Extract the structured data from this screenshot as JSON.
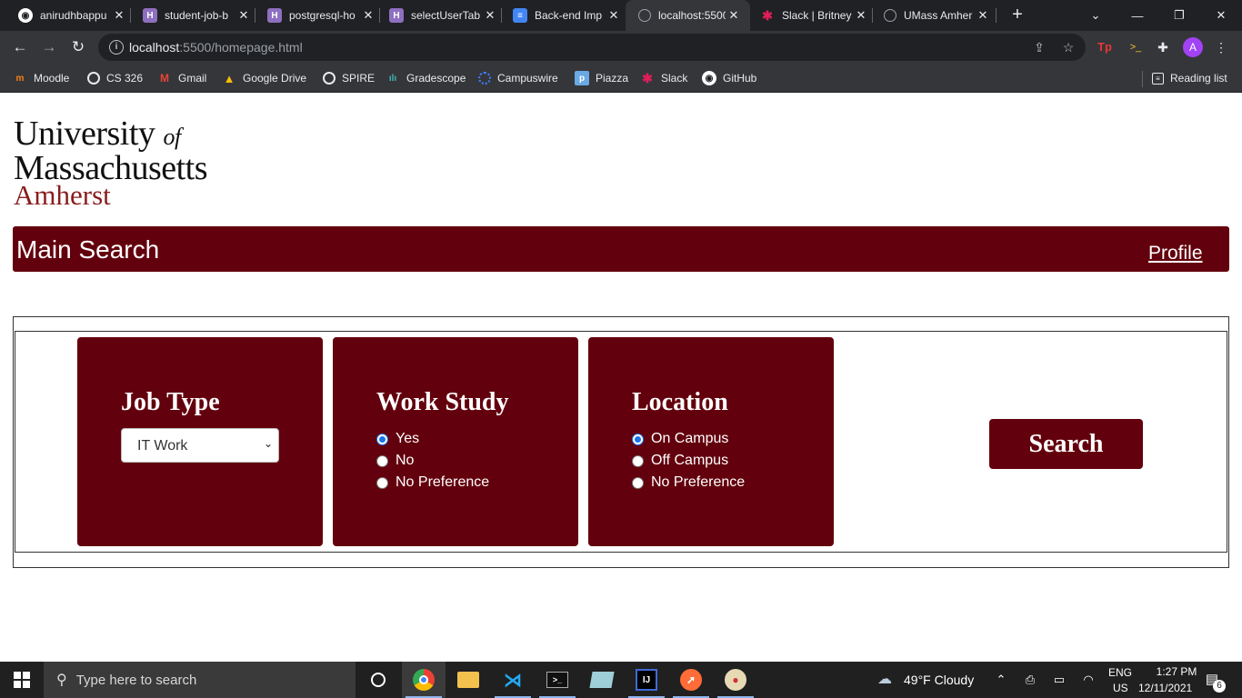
{
  "browser": {
    "tabs": [
      {
        "title": "anirudhbappu",
        "icon": "github-icon",
        "color": "#ffffff"
      },
      {
        "title": "student-job-b",
        "icon": "hackmd-icon",
        "color": "#8e6fc0"
      },
      {
        "title": "postgresql-ho",
        "icon": "hackmd-icon",
        "color": "#8e6fc0"
      },
      {
        "title": "selectUserTab",
        "icon": "hackmd-icon",
        "color": "#8e6fc0"
      },
      {
        "title": "Back-end Imp",
        "icon": "google-docs-icon",
        "color": "#4285f4"
      },
      {
        "title": "localhost:5500",
        "icon": "globe-icon",
        "color": "#9aa0a6"
      },
      {
        "title": "Slack | Britney",
        "icon": "slack-icon",
        "color": "#e01e5a"
      },
      {
        "title": "UMass Amher",
        "icon": "globe-icon",
        "color": "#9aa0a6"
      }
    ],
    "active_tab_index": 5,
    "close_glyph": "✕",
    "new_tab_glyph": "+",
    "url_host": "localhost",
    "url_rest": ":5500/homepage.html",
    "bookmarks": [
      {
        "label": "Moodle",
        "icon": "moodle-icon",
        "color": "#f98012"
      },
      {
        "label": "CS 326",
        "icon": "globe-icon",
        "color": "#e8eaed"
      },
      {
        "label": "Gmail",
        "icon": "gmail-icon",
        "color": "#ea4335"
      },
      {
        "label": "Google Drive",
        "icon": "google-drive-icon",
        "color": "#fbbc04"
      },
      {
        "label": "SPIRE",
        "icon": "globe-icon",
        "color": "#e8eaed"
      },
      {
        "label": "Gradescope",
        "icon": "gradescope-icon",
        "color": "#3fb6b0"
      },
      {
        "label": "Campuswire",
        "icon": "campuswire-icon",
        "color": "#3d7eff"
      },
      {
        "label": "Piazza",
        "icon": "piazza-icon",
        "color": "#6aa9e4"
      },
      {
        "label": "Slack",
        "icon": "slack-icon",
        "color": "#e01e5a"
      },
      {
        "label": "GitHub",
        "icon": "github-icon",
        "color": "#ffffff"
      }
    ],
    "reading_list": "Reading list",
    "profile_initial": "A"
  },
  "page": {
    "logo": {
      "line1": "University",
      "line1_of": "of",
      "line2": "Massachusetts",
      "line3": "Amherst"
    },
    "header": {
      "title": "Main Search",
      "profile_link": "Profile"
    },
    "job_type": {
      "heading": "Job Type",
      "selected": "IT Work"
    },
    "work_study": {
      "heading": "Work Study",
      "options": [
        "Yes",
        "No",
        "No Preference"
      ],
      "selected_index": 0
    },
    "location": {
      "heading": "Location",
      "options": [
        "On Campus",
        "Off Campus",
        "No Preference"
      ],
      "selected_index": 0
    },
    "search_button": "Search",
    "brand_color": "#63000d"
  },
  "taskbar": {
    "search_placeholder": "Type here to search",
    "weather": "49°F  Cloudy",
    "lang_top": "ENG",
    "lang_bottom": "US",
    "time": "1:27 PM",
    "date": "12/11/2021",
    "notification_count": "6"
  }
}
